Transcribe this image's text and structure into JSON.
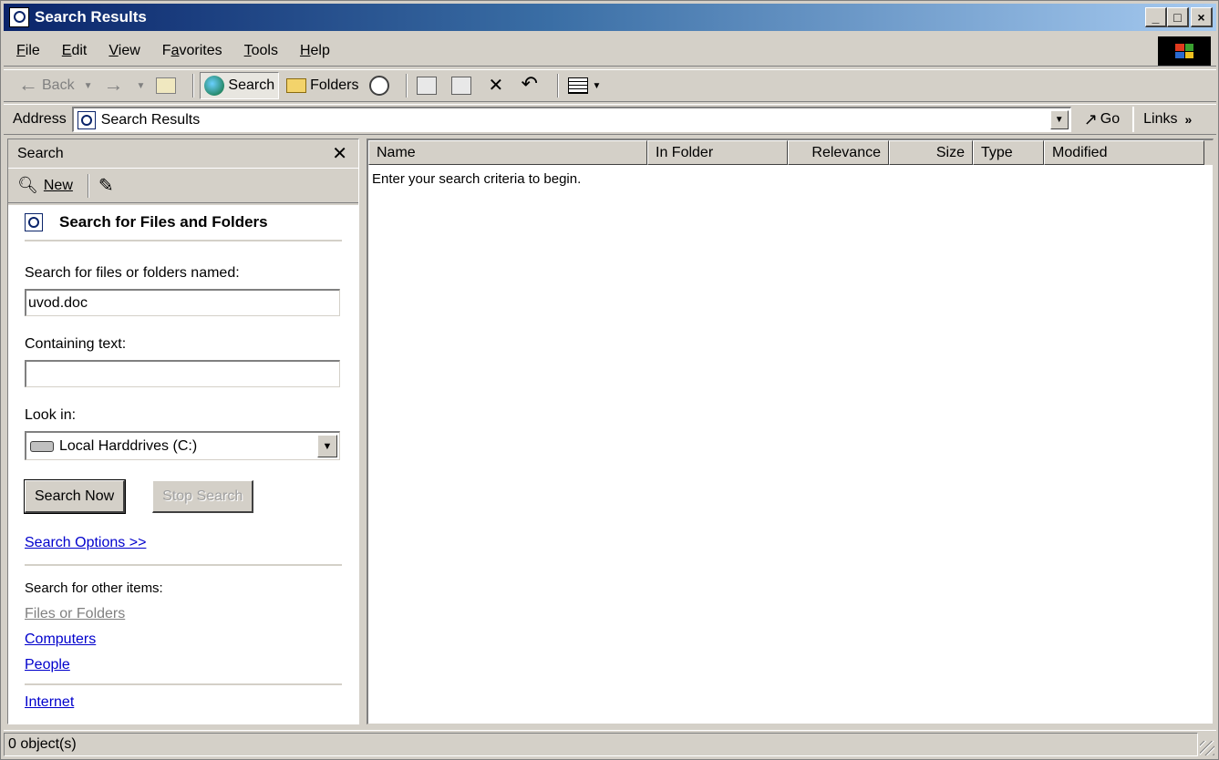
{
  "window": {
    "title": "Search Results",
    "controls": {
      "minimize": "_",
      "maximize": "□",
      "close": "×"
    }
  },
  "menubar": {
    "items": [
      {
        "label": "File",
        "u": "F",
        "rest": "ile"
      },
      {
        "label": "Edit",
        "u": "E",
        "rest": "dit"
      },
      {
        "label": "View",
        "u": "V",
        "rest": "iew"
      },
      {
        "label": "Favorites",
        "pre": "F",
        "u": "a",
        "rest": "vorites"
      },
      {
        "label": "Tools",
        "u": "T",
        "rest": "ools"
      },
      {
        "label": "Help",
        "u": "H",
        "rest": "elp"
      }
    ]
  },
  "toolbar": {
    "back_label": "Back",
    "search_label": "Search",
    "folders_label": "Folders"
  },
  "addressbar": {
    "label": "Address",
    "value": "Search Results",
    "go_label": "Go",
    "links_label": "Links",
    "links_chevron": "»"
  },
  "search_pane": {
    "header": "Search",
    "close_glyph": "✕",
    "new_label": "New",
    "title": "Search for Files and Folders",
    "named_label": "Search for files or folders named:",
    "named_value": "uvod.doc",
    "containing_label": "Containing text:",
    "containing_value": "",
    "lookin_label": "Look in:",
    "lookin_value": "Local Harddrives (C:)",
    "search_now": "Search Now",
    "stop_search": "Stop Search",
    "search_options": "Search Options >>",
    "other_items_label": "Search for other items:",
    "other_items": {
      "files_or_folders": "Files or Folders",
      "computers": "Computers",
      "people": "People",
      "internet": "Internet"
    }
  },
  "results": {
    "columns": [
      "Name",
      "In Folder",
      "Relevance",
      "Size",
      "Type",
      "Modified"
    ],
    "empty_message": "Enter your search criteria to begin."
  },
  "statusbar": {
    "text": "0 object(s)"
  },
  "colors": {
    "title_gradient_start": "#0a246a",
    "title_gradient_end": "#a6caf0",
    "face": "#d4d0c8",
    "link": "#0000cc"
  }
}
